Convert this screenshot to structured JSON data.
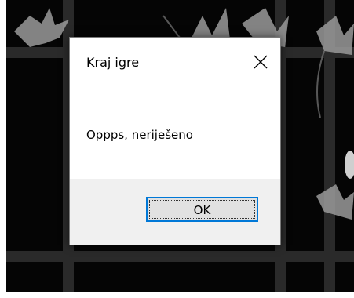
{
  "dialog": {
    "title": "Kraj igre",
    "message": "Oppps, neriješeno",
    "ok_label": "OK",
    "close_icon": "close-icon"
  },
  "background": {
    "description_icons": [
      "leaf-icon"
    ]
  },
  "colors": {
    "accent": "#0078d7",
    "button_area": "#f0f0f0",
    "button_face": "#e1e1e1",
    "backdrop": "#050505"
  }
}
